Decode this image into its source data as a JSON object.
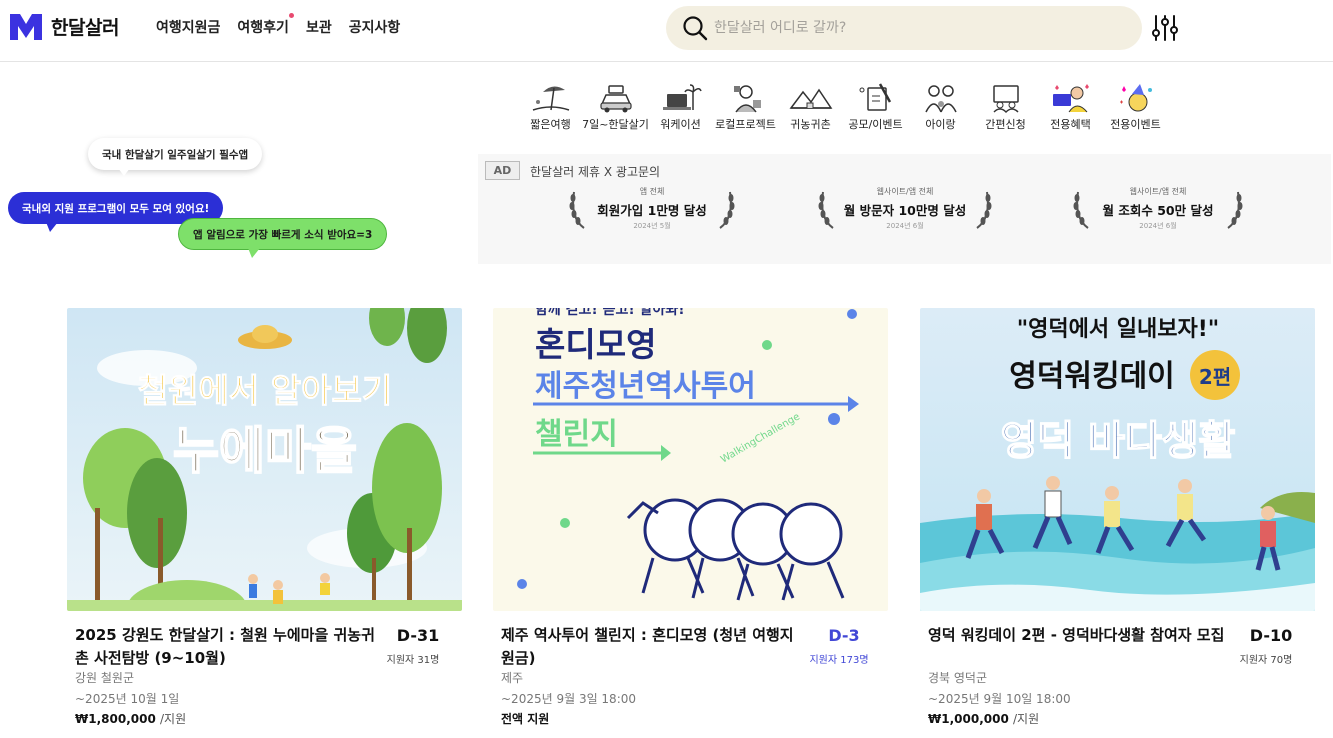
{
  "header": {
    "logo_text": "한달살러",
    "nav": [
      {
        "label": "여행지원금"
      },
      {
        "label": "여행후기"
      },
      {
        "label": "보관"
      },
      {
        "label": "공지사항"
      }
    ],
    "search_placeholder": "한달살러 어디로 갈까?"
  },
  "categories": [
    {
      "label": "짧은여행",
      "icon": "beach-umbrella-icon"
    },
    {
      "label": "7일~한달살기",
      "icon": "car-luggage-icon"
    },
    {
      "label": "워케이션",
      "icon": "laptop-palm-icon"
    },
    {
      "label": "로컬프로젝트",
      "icon": "local-people-icon"
    },
    {
      "label": "귀농귀촌",
      "icon": "farm-house-icon"
    },
    {
      "label": "공모/이벤트",
      "icon": "contest-pencil-icon"
    },
    {
      "label": "아이랑",
      "icon": "family-icon"
    },
    {
      "label": "간편신청",
      "icon": "easy-apply-icon"
    },
    {
      "label": "전용혜택",
      "icon": "exclusive-benefit-icon"
    },
    {
      "label": "전용이벤트",
      "icon": "exclusive-event-icon"
    }
  ],
  "bubbles": {
    "b1": "국내 한달살기 일주일살기 필수앱",
    "b2": "국내외 지원 프로그램이 모두 모여 있어요!",
    "b3": "앱 알림으로 가장 빠르게 소식 받아요=3"
  },
  "ad": {
    "badge": "AD",
    "text": "한달살러 제휴 X 광고문의",
    "awards": [
      {
        "sub": "앱 전체",
        "main": "회원가입 1만명 달성",
        "date": "2024년 5월"
      },
      {
        "sub": "웹사이트/앱 전체",
        "main": "월 방문자 10만명 달성",
        "date": "2024년 6월"
      },
      {
        "sub": "웹사이트/앱 전체",
        "main": "월 조회수 50만 달성",
        "date": "2024년 6월"
      }
    ]
  },
  "cards": [
    {
      "image_text": [
        "철원에서 알아보기",
        "누에마을"
      ],
      "title": "2025 강원도 한달살기 : 철원 누에마을 귀농귀촌 사전탐방 (9~10월)",
      "dday": "D-31",
      "applicants": "지원자 31명",
      "location": "강원 철원군",
      "deadline": "~2025년 10월 1일",
      "price": "₩1,800,000",
      "price_unit": "/지원"
    },
    {
      "image_text": [
        "함께 걷고! 듣고! 알아봐!",
        "혼디모영",
        "제주청년역사투어",
        "챌린지",
        "WalkingChallenge"
      ],
      "title": "제주 역사투어 챌린지 : 혼디모영 (청년 여행지원금)",
      "dday": "D-3",
      "applicants": "지원자 173명",
      "location": "제주",
      "deadline": "~2025년 9월 3일 18:00",
      "price": "전액 지원",
      "price_unit": ""
    },
    {
      "image_text": [
        "\"영덕에서 일내보자!\"",
        "영덕워킹데이",
        "2편",
        "영덕 바다생활"
      ],
      "title": "영덕 워킹데이 2편 - 영덕바다생활 참여자 모집",
      "dday": "D-10",
      "applicants": "지원자 70명",
      "location": "경북 영덕군",
      "deadline": "~2025년 9월 10일 18:00",
      "price": "₩1,000,000",
      "price_unit": "/지원"
    }
  ],
  "colors": {
    "brand": "#3b32e0",
    "search_bg": "#f3efe1",
    "dday_highlight": "#4147d6"
  }
}
